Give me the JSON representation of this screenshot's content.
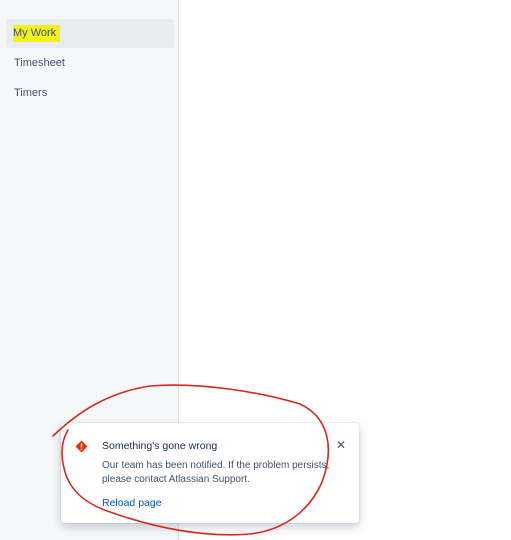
{
  "sidebar": {
    "items": [
      {
        "label": "My Work",
        "active": true,
        "highlight_color": "#f2f21a"
      },
      {
        "label": "Timesheet",
        "active": false
      },
      {
        "label": "Timers",
        "active": false
      }
    ]
  },
  "flag": {
    "icon": "warning-icon",
    "icon_color": "#de350b",
    "title": "Something's gone wrong",
    "close_icon": "close-icon",
    "body": "Our team has been notified. If the problem persists, please contact Atlassian Support.",
    "action_label": "Reload page"
  },
  "annotation": {
    "shape": "hand-drawn-circle",
    "color": "#d42a22"
  }
}
